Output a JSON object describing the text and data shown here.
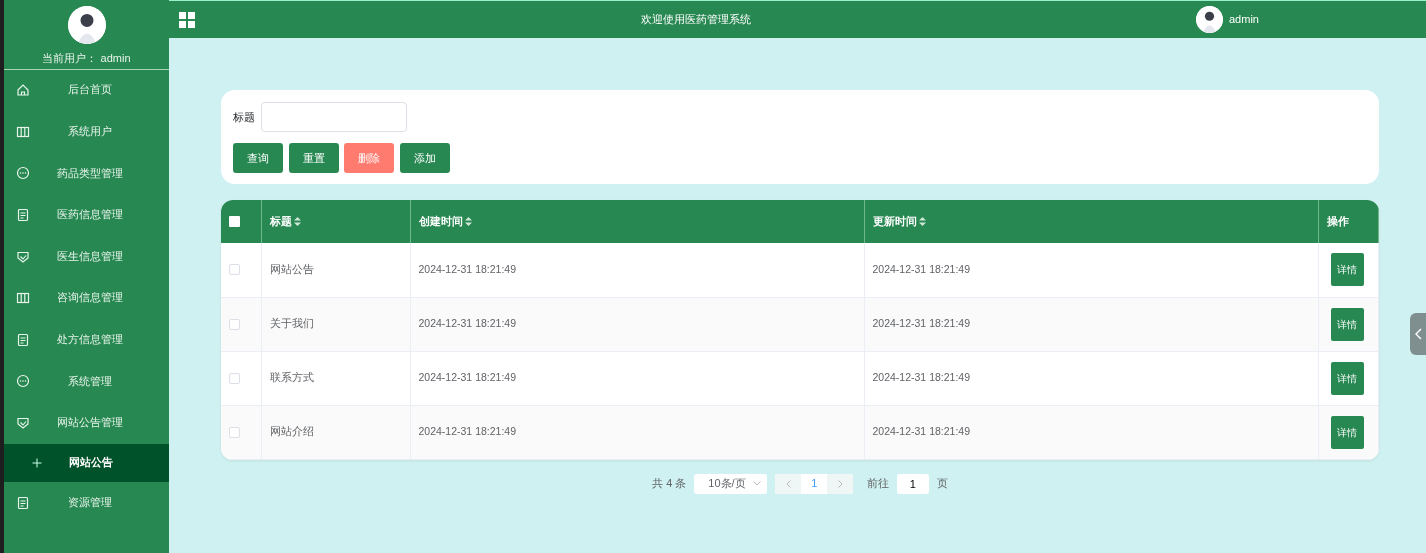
{
  "sidebar": {
    "current_user_label": "当前用户：",
    "current_user": "admin",
    "items": [
      {
        "label": "后台首页",
        "kind": "home"
      },
      {
        "label": "系统用户",
        "kind": "columns"
      },
      {
        "label": "药品类型管理",
        "kind": "chat"
      },
      {
        "label": "医药信息管理",
        "kind": "doc"
      },
      {
        "label": "医生信息管理",
        "kind": "shield"
      },
      {
        "label": "咨询信息管理",
        "kind": "columns"
      },
      {
        "label": "处方信息管理",
        "kind": "doc"
      },
      {
        "label": "系统管理",
        "kind": "chat"
      },
      {
        "label": "网站公告管理",
        "kind": "shield",
        "children": [
          {
            "label": "网站公告",
            "selected": true
          }
        ]
      },
      {
        "label": "资源管理",
        "kind": "doc"
      }
    ]
  },
  "header": {
    "title": "欢迎使用医药管理系统",
    "user": "admin"
  },
  "search": {
    "label": "标题",
    "buttons": [
      {
        "label": "查询",
        "kind": "primary"
      },
      {
        "label": "重置",
        "kind": "primary"
      },
      {
        "label": "删除",
        "kind": "danger"
      },
      {
        "label": "添加",
        "kind": "primary"
      }
    ]
  },
  "table": {
    "columns": [
      {
        "label": "标题",
        "sortable": true
      },
      {
        "label": "创建时间",
        "sortable": true
      },
      {
        "label": "更新时间",
        "sortable": true
      },
      {
        "label": "操作",
        "sortable": false
      }
    ],
    "select_all_checked": false,
    "rows": [
      {
        "checked": false,
        "cells": [
          "网站公告",
          "2024-12-31 18:21:49",
          "2024-12-31 18:21:49"
        ],
        "action": "详情"
      },
      {
        "checked": false,
        "cells": [
          "关于我们",
          "2024-12-31 18:21:49",
          "2024-12-31 18:21:49"
        ],
        "action": "详情"
      },
      {
        "checked": false,
        "cells": [
          "联系方式",
          "2024-12-31 18:21:49",
          "2024-12-31 18:21:49"
        ],
        "action": "详情"
      },
      {
        "checked": false,
        "cells": [
          "网站介绍",
          "2024-12-31 18:21:49",
          "2024-12-31 18:21:49"
        ],
        "action": "详情"
      }
    ]
  },
  "pagination": {
    "total": "共 4 条",
    "page_size": "10条/页",
    "pages": [
      {
        "label": "1",
        "selected": true
      }
    ],
    "goto_label": "前往",
    "goto_value": "1",
    "page_suffix": "页"
  }
}
